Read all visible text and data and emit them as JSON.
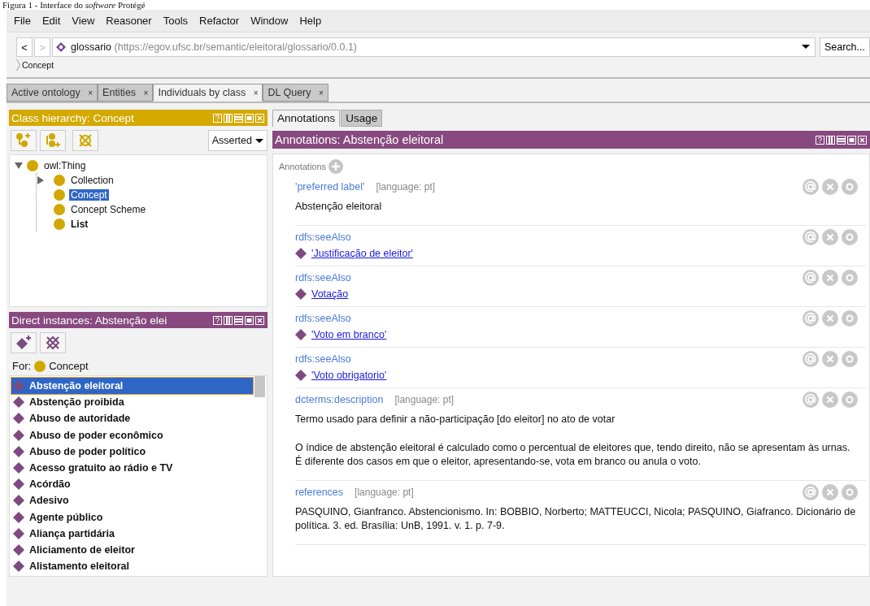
{
  "caption": "Figura 1 - Interface do *software* Protégé",
  "menu": [
    "File",
    "Edit",
    "View",
    "Reasoner",
    "Tools",
    "Refactor",
    "Window",
    "Help"
  ],
  "address": {
    "back": "<",
    "forward": ">",
    "name": "glossario",
    "iri": "(https://egov.ufsc.br/semantic/eleitoral/glossario/0.0.1)",
    "search": "Search..."
  },
  "breadcrumb": "Concept",
  "tabs": [
    {
      "label": "Active ontology",
      "close": "×",
      "selected": false
    },
    {
      "label": "Entities",
      "close": "×",
      "selected": false
    },
    {
      "label": "Individuals by class",
      "close": "×",
      "selected": true
    },
    {
      "label": "DL Query",
      "close": "×",
      "selected": false
    }
  ],
  "class_hierarchy": {
    "title": "Class hierarchy: Concept",
    "mode": "Asserted",
    "tree": [
      {
        "label": "owl:Thing",
        "selected": false,
        "bold": false,
        "expanded": true,
        "children": [
          {
            "label": "Collection",
            "selected": false,
            "bold": false,
            "expanded": false
          },
          {
            "label": "Concept",
            "selected": true,
            "bold": false
          },
          {
            "label": "Concept Scheme",
            "selected": false,
            "bold": false
          },
          {
            "label": "List",
            "selected": false,
            "bold": true
          }
        ]
      }
    ]
  },
  "direct_instances": {
    "title": "Direct instances: Abstenção elei",
    "for_label": "For:",
    "for_class": "Concept",
    "items": [
      {
        "label": "Abstenção eleitoral",
        "selected": true
      },
      {
        "label": "Abstenção proibida",
        "selected": false
      },
      {
        "label": "Abuso de autoridade",
        "selected": false
      },
      {
        "label": "Abuso de poder econômico",
        "selected": false
      },
      {
        "label": "Abuso de poder político",
        "selected": false
      },
      {
        "label": "Acesso gratuito ao rádio e TV",
        "selected": false
      },
      {
        "label": "Acórdão",
        "selected": false
      },
      {
        "label": "Adesivo",
        "selected": false
      },
      {
        "label": "Agente público",
        "selected": false
      },
      {
        "label": "Aliança partidária",
        "selected": false
      },
      {
        "label": "Aliciamento de eleitor",
        "selected": false
      },
      {
        "label": "Alistamento eleitoral",
        "selected": false
      }
    ]
  },
  "right_tabs": [
    {
      "label": "Annotations",
      "selected": true
    },
    {
      "label": "Usage",
      "selected": false
    }
  ],
  "annotations": {
    "title": "Annotations: Abstenção eleitoral",
    "heading": "Annotations",
    "items": [
      {
        "property": "'preferred label'",
        "language": "[language: pt]",
        "kind": "text",
        "paragraphs": [
          "Abstenção eleitoral"
        ]
      },
      {
        "property": "rdfs:seeAlso",
        "kind": "individual",
        "paragraphs": [
          "'Justificação de eleitor'"
        ]
      },
      {
        "property": "rdfs:seeAlso",
        "kind": "individual",
        "paragraphs": [
          "Votação"
        ]
      },
      {
        "property": "rdfs:seeAlso",
        "kind": "individual",
        "paragraphs": [
          "'Voto em branco'"
        ]
      },
      {
        "property": "rdfs:seeAlso",
        "kind": "individual",
        "paragraphs": [
          "'Voto obrigatorio'"
        ]
      },
      {
        "property": "dcterms:description",
        "language": "[language: pt]",
        "kind": "text",
        "paragraphs": [
          "Termo usado para definir a não-participação [do eleitor] no ato de votar",
          "O índice de abstenção eleitoral é calculado como o percentual de eleitores que, tendo direito, não se apresentam às urnas. É diferente dos casos em que o eleitor, apresentando-se, vota em branco ou anula o voto."
        ]
      },
      {
        "property": "references",
        "language": "[language: pt]",
        "kind": "text",
        "paragraphs": [
          "PASQUINO, Gianfranco. Abstencionismo. In: BOBBIO, Norberto; MATTEUCCI, Nicola; PASQUINO, Giafranco. Dicionário de política. 3. ed. Brasília: UnB, 1991. v. 1. p. 7-9."
        ]
      }
    ]
  }
}
